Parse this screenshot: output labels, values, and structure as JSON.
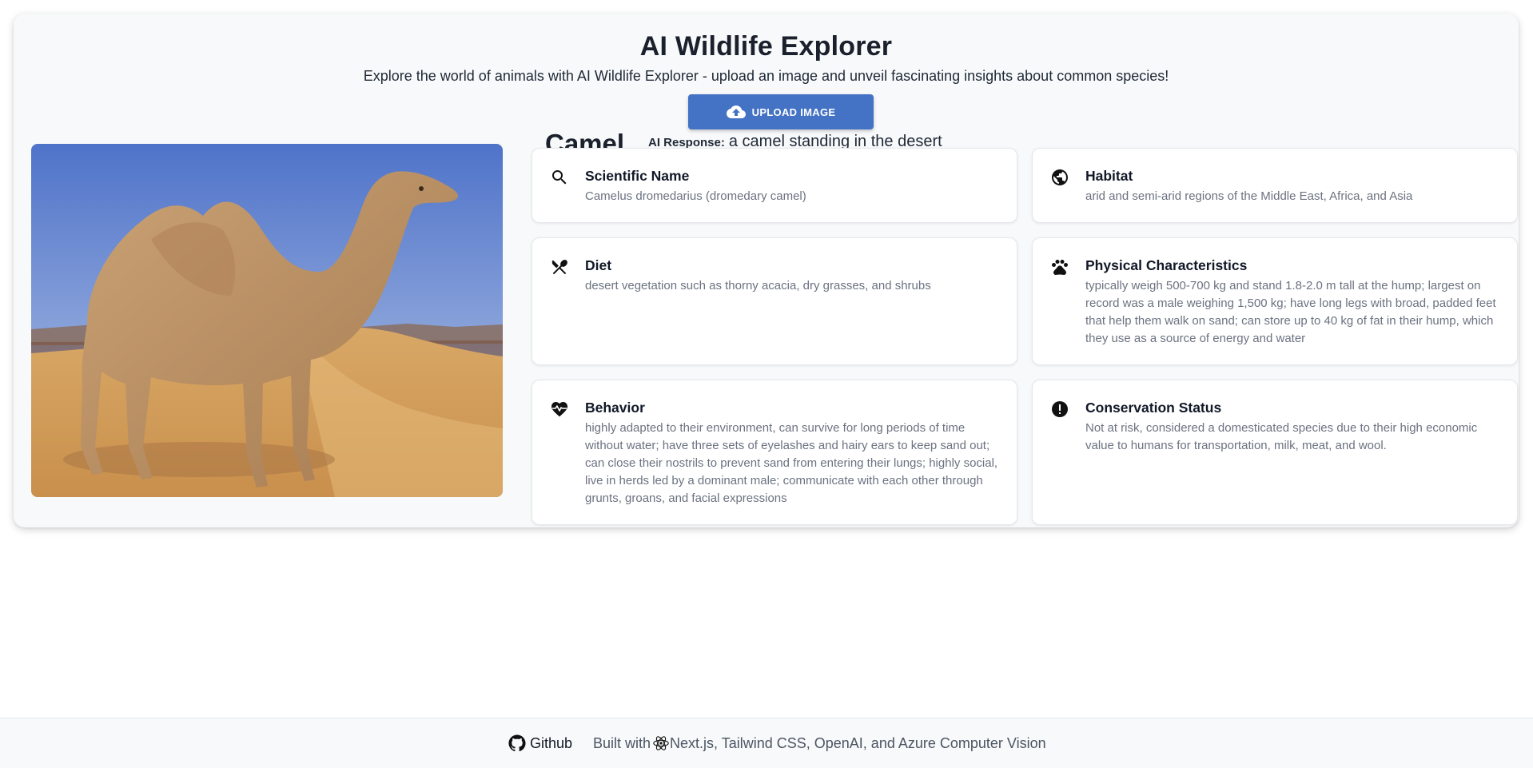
{
  "header": {
    "title": "AI Wildlife Explorer",
    "subtitle": "Explore the world of animals with AI Wildlife Explorer - upload an image and unveil fascinating insights about common species!",
    "upload_button": "UPLOAD IMAGE",
    "upload_icon": "cloud-upload-icon"
  },
  "result": {
    "animal_name": "Camel",
    "ai_response_label": "AI Response:",
    "ai_response_text": "a camel standing in the desert",
    "image": "camel-photo"
  },
  "cards": [
    {
      "icon": "search-icon",
      "title": "Scientific Name",
      "text": "Camelus dromedarius (dromedary camel)"
    },
    {
      "icon": "globe-icon",
      "title": "Habitat",
      "text": "arid and semi-arid regions of the Middle East, Africa, and Asia"
    },
    {
      "icon": "utensils-icon",
      "title": "Diet",
      "text": "desert vegetation such as thorny acacia, dry grasses, and shrubs"
    },
    {
      "icon": "paw-icon",
      "title": "Physical Characteristics",
      "text": "typically weigh 500-700 kg and stand 1.8-2.0 m tall at the hump; largest on record was a male weighing 1,500 kg; have long legs with broad, padded feet that help them walk on sand; can store up to 40 kg of fat in their hump, which they use as a source of energy and water"
    },
    {
      "icon": "heartbeat-icon",
      "title": "Behavior",
      "text": "highly adapted to their environment, can survive for long periods of time without water; have three sets of eyelashes and hairy ears to keep sand out; can close their nostrils to prevent sand from entering their lungs; highly social, live in herds led by a dominant male; communicate with each other through grunts, groans, and facial expressions"
    },
    {
      "icon": "exclamation-circle-icon",
      "title": "Conservation Status",
      "text": "Not at risk, considered a domesticated species due to their high economic value to humans for transportation, milk, meat, and wool."
    }
  ],
  "footer": {
    "github_label": "Github",
    "built_with_prefix": "Built with",
    "built_with_text": "Next.js, Tailwind CSS, OpenAI, and Azure Computer Vision"
  },
  "colors": {
    "primary_button": "#4472c4",
    "card_background": "#ffffff",
    "panel_background": "#f8f9fa",
    "muted_text": "#6b7280"
  }
}
